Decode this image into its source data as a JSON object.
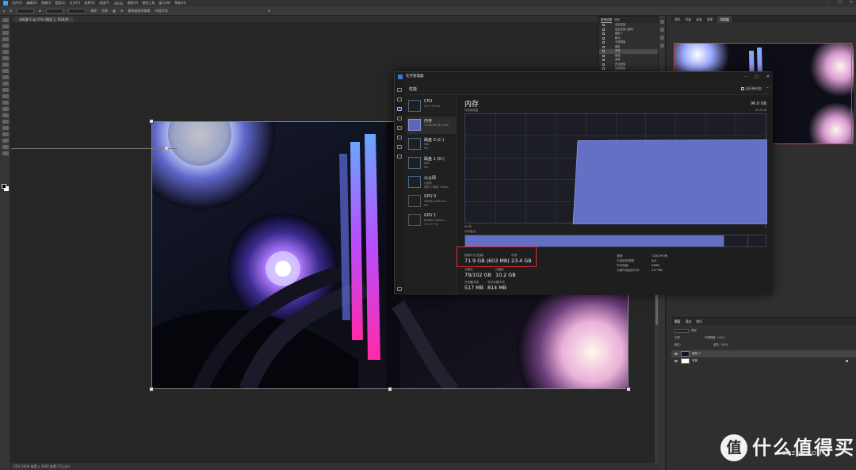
{
  "task_manager": {
    "window_title": "任务管理器",
    "header_title": "性能",
    "header_button": "运行新任务",
    "sidebar": [
      {
        "name": "CPU",
        "sub": "2% 3.74 GHz",
        "sub2": ""
      },
      {
        "name": "内存",
        "sub": "72.4/95.8 GB (76%)",
        "sub2": ""
      },
      {
        "name": "磁盘 0 (C:)",
        "sub": "SSD",
        "sub2": "0%"
      },
      {
        "name": "磁盘 1 (D:)",
        "sub": "SSD",
        "sub2": "0%"
      },
      {
        "name": "以太网",
        "sub": "以太网",
        "sub2": "发送: 0 接收: 0 Kbps"
      },
      {
        "name": "GPU 0",
        "sub": "Intel(R) UHD Gra...",
        "sub2": "0%"
      },
      {
        "name": "GPU 1",
        "sub": "NVIDIA GeForce...",
        "sub2": "1% (37 °C)"
      }
    ],
    "memory": {
      "title": "内存",
      "subtitle": "内存使用量",
      "total": "96.0 GB",
      "total_sub": "95.8 GB",
      "graph_left_label": "60 秒",
      "graph_right_label": "0",
      "composition_label": "内存组合",
      "usage_fraction": 0.76,
      "stats": {
        "in_use_label": "使用中(已压缩)",
        "in_use_value": "71.9 GB (603 MB)",
        "available_label": "可用",
        "available_value": "23.4 GB",
        "committed_label": "已提交",
        "committed_value": "79/102 GB",
        "cached_label": "已缓存",
        "cached_value": "10.2 GB",
        "paged_pool_label": "分页缓冲池",
        "paged_pool_value": "517 MB",
        "nonpaged_pool_label": "非分页缓冲池",
        "nonpaged_pool_value": "814 MB"
      },
      "details": [
        {
          "k": "速度:",
          "v": "7200 MT/秒"
        },
        {
          "k": "已使用的插槽:",
          "v": "4/4"
        },
        {
          "k": "外形规格:",
          "v": "DIMM"
        },
        {
          "k": "为硬件保留的内存:",
          "v": "237 MB"
        }
      ]
    }
  },
  "photoshop": {
    "doc_tab": "未标题-1 @ 25% (图层 1, RGB/8)",
    "status": "25%  5000 像素 x 3000 像素 (72 ppi)",
    "menu": [
      "文件(F)",
      "编辑(E)",
      "图像(I)",
      "图层(L)",
      "文字(Y)",
      "选择(S)",
      "滤镜(T)",
      "3D(D)",
      "视图(V)",
      "增效工具",
      "窗口(W)",
      "帮助(H)"
    ],
    "options": [
      "宽度",
      "高度",
      "分辨率",
      "清除",
      "拉直",
      "叠加选项",
      "删除裁剪的像素",
      "内容识别"
    ],
    "history_tabs": [
      "历史记录",
      "动作"
    ],
    "history_items": [
      "自由变换",
      "自由变换 (旋转)",
      "图层 1",
      "移动",
      "不透明度",
      "裁剪",
      "变换",
      "画笔",
      "选择",
      "拼合图像",
      "复制图层",
      "自由变换"
    ],
    "nav_tabs": [
      "颜色",
      "色板",
      "渐变",
      "图案",
      "导航器"
    ],
    "layer_tabs": [
      "图层",
      "通道",
      "路径"
    ],
    "layer_kind": "类型",
    "blend_mode": "正常",
    "opacity_label": "不透明度:",
    "opacity_value": "100%",
    "lock_label": "锁定:",
    "fill_label": "填充:",
    "fill_value": "100%",
    "layers": [
      {
        "name": "图层 1"
      },
      {
        "name": "背景"
      }
    ]
  },
  "watermark": {
    "logo_char": "值",
    "text": "什么值得买",
    "small": "SMZDM.COM"
  },
  "colors": {
    "accent_memory": "#6470c4",
    "highlight_box": "#e02a2a"
  }
}
